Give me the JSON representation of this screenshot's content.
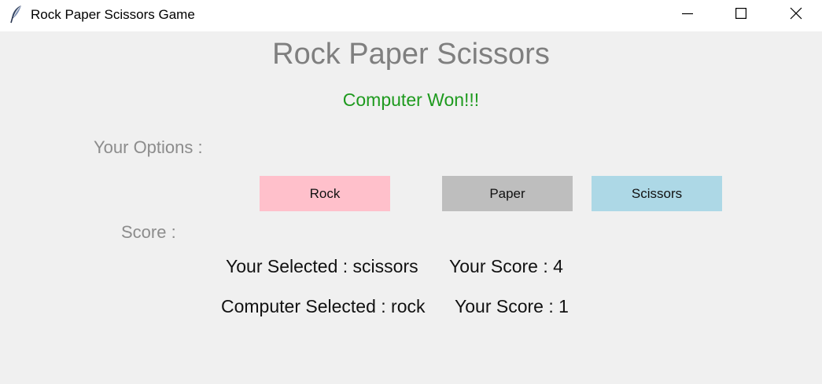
{
  "window": {
    "title": "Rock Paper Scissors Game",
    "icon": "feather-icon",
    "controls": [
      "minimize-icon",
      "maximize-icon",
      "close-icon"
    ]
  },
  "game": {
    "heading": "Rock Paper Scissors",
    "result_text": "Computer Won!!!",
    "options_label": "Your Options :",
    "score_label": "Score :"
  },
  "buttons": [
    {
      "label": "Rock",
      "color": "#ffc0cb"
    },
    {
      "label": "Paper",
      "color": "#bebebe"
    },
    {
      "label": "Scissors",
      "color": "#add8e6"
    }
  ],
  "stats": {
    "user_selected": "Your Selected : scissors",
    "user_score": "Your Score : 4",
    "computer_selected": "Computer Selected : rock",
    "computer_score": "Your Score : 1"
  },
  "colors": {
    "result": "#1e9a1e",
    "heading": "#7f7f7f",
    "label": "#8c8c8c",
    "background": "#f0f0f0"
  }
}
